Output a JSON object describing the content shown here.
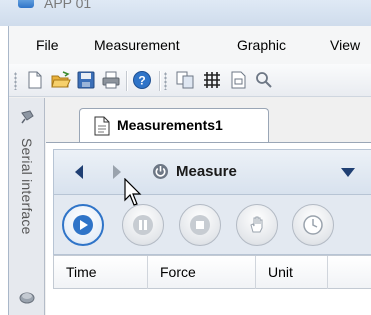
{
  "window": {
    "title": "APP 01"
  },
  "menu": [
    "File",
    "Measurement",
    "Graphic",
    "View"
  ],
  "toolbar": {
    "buttons": [
      "new-document-icon",
      "open-folder-icon",
      "save-icon",
      "print-icon",
      "help-icon",
      "copy-icon",
      "grid-icon",
      "page-icon",
      "search-icon"
    ]
  },
  "side_panel": {
    "label": "Serial interface"
  },
  "document_tab": {
    "label": "Measurements1"
  },
  "measure_panel": {
    "title": "Measure"
  },
  "controls": [
    "play-icon",
    "pause-icon",
    "stop-icon",
    "hand-icon",
    "clock-icon"
  ],
  "table": {
    "columns": [
      "Time",
      "Force",
      "Unit"
    ]
  },
  "colors": {
    "accent": "#2f74c8",
    "nav_active": "#1f3f73",
    "nav_disabled": "#9aa3ad"
  }
}
